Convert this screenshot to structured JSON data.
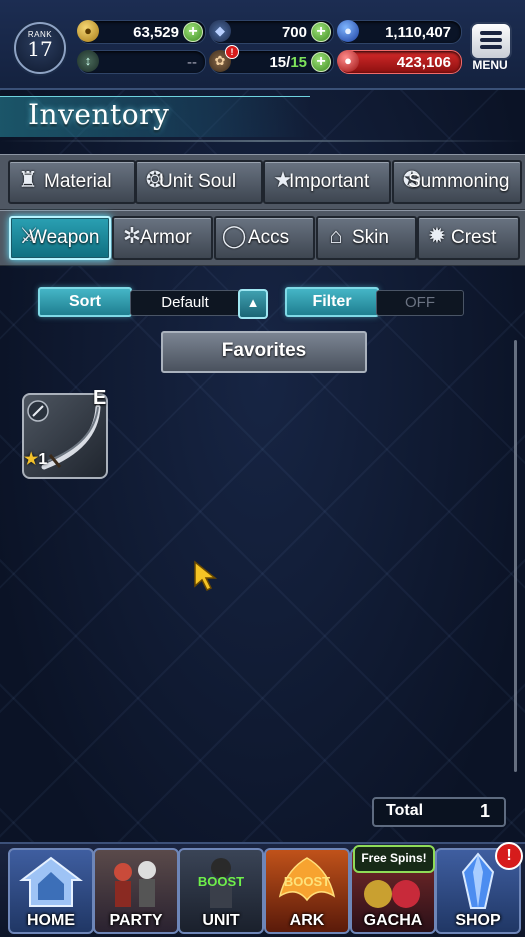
{
  "hud": {
    "rank_label": "RANK",
    "rank_value": "17",
    "gil": "63,529",
    "crystals": "700",
    "gems": "1,110,407",
    "blank_value": "--",
    "capacity": "15/",
    "capacity_max": "15",
    "energy": "423,106",
    "menu_label": "MENU"
  },
  "page_title": "Inventory",
  "tabs_row1": [
    {
      "label": "Material",
      "icon": "bag-icon"
    },
    {
      "label": "Unit Soul",
      "icon": "flame-icon"
    },
    {
      "label": "Important",
      "icon": "star-icon"
    },
    {
      "label": "Summoning",
      "icon": "summon-icon"
    }
  ],
  "tabs_row2": [
    {
      "label": "Weapon",
      "icon": "sword-icon",
      "active": true
    },
    {
      "label": "Armor",
      "icon": "armor-icon"
    },
    {
      "label": "Accs",
      "icon": "ring-icon"
    },
    {
      "label": "Skin",
      "icon": "hanger-icon"
    },
    {
      "label": "Crest",
      "icon": "crest-icon"
    }
  ],
  "controls": {
    "sort_label": "Sort",
    "sort_value": "Default",
    "filter_label": "Filter",
    "filter_value": "OFF",
    "favorites_label": "Favorites"
  },
  "items": [
    {
      "name": "curved-sword",
      "grade": "E",
      "stars": "1"
    }
  ],
  "total": {
    "label": "Total",
    "value": "1"
  },
  "bottom_nav": [
    {
      "label": "HOME"
    },
    {
      "label": "PARTY"
    },
    {
      "label": "UNIT",
      "badge": "BOOST"
    },
    {
      "label": "ARK",
      "badge": "BOOST"
    },
    {
      "label": "GACHA",
      "tag": "Free Spins!"
    },
    {
      "label": "SHOP",
      "alert": "!"
    }
  ],
  "colors": {
    "accent_teal": "#2aa0b3",
    "plus_green": "#5cb83a",
    "energy_red": "#c81e1e",
    "star_gold": "#f2c12b"
  }
}
